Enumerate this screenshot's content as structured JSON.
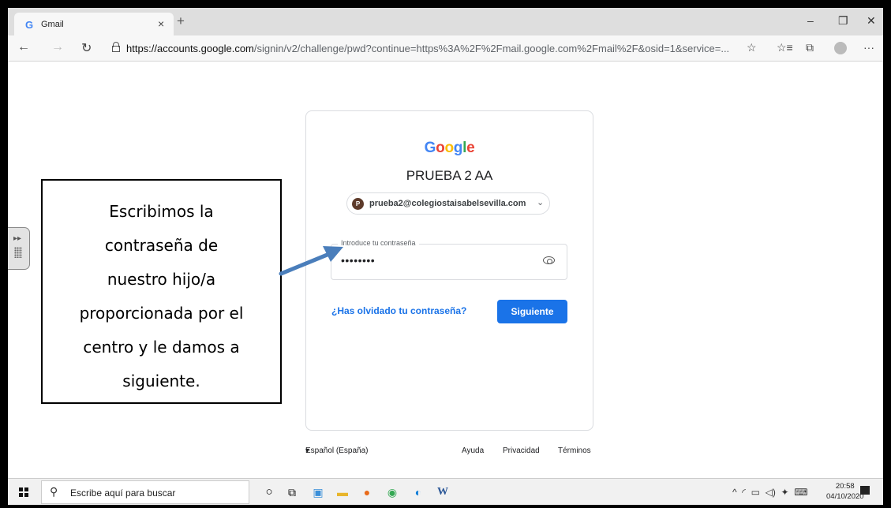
{
  "browser": {
    "tab_title": "Gmail",
    "tab_favicon": "G",
    "tab_close": "×",
    "new_tab": "+",
    "window_controls": {
      "minimize": "–",
      "restore": "❐",
      "close": "✕"
    },
    "nav": {
      "back": "←",
      "forward": "→",
      "refresh": "↻"
    },
    "url_host": "https://accounts.google.com",
    "url_path": "/signin/v2/challenge/pwd?continue=https%3A%2F%2Fmail.google.com%2Fmail%2F&osid=1&service=...",
    "toolbar_icons": {
      "favorite": "☆",
      "favorites_list": "☆≡",
      "collections": "⧉",
      "more": "···"
    }
  },
  "signin": {
    "logo_letters": [
      {
        "char": "G",
        "color": "#4285F4"
      },
      {
        "char": "o",
        "color": "#EA4335"
      },
      {
        "char": "o",
        "color": "#FBBC05"
      },
      {
        "char": "g",
        "color": "#4285F4"
      },
      {
        "char": "l",
        "color": "#34A853"
      },
      {
        "char": "e",
        "color": "#EA4335"
      }
    ],
    "account_name": "PRUEBA 2 AA",
    "avatar_letter": "P",
    "email": "prueba2@colegiostaisabelsevilla.com",
    "chevron": "⌄",
    "password_label": "Introduce tu contraseña",
    "password_value": "••••••••",
    "forgot_link": "¿Has olvidado tu contraseña?",
    "next_button": "Siguiente"
  },
  "footer": {
    "language": "Español (España)",
    "language_arrow": "▾",
    "help": "Ayuda",
    "privacy": "Privacidad",
    "terms": "Términos"
  },
  "callout": {
    "lines": [
      "Escribimos la",
      "contraseña de",
      "nuestro hijo/a",
      "proporcionada por el",
      "centro y le damos a",
      "siguiente."
    ]
  },
  "taskbar": {
    "search_placeholder": "Escribe aquí para buscar",
    "time": "20:58",
    "date": "04/10/2020",
    "tray_up": "^"
  },
  "colors": {
    "accent": "#1a73e8",
    "arrow": "#4a7ebb"
  }
}
